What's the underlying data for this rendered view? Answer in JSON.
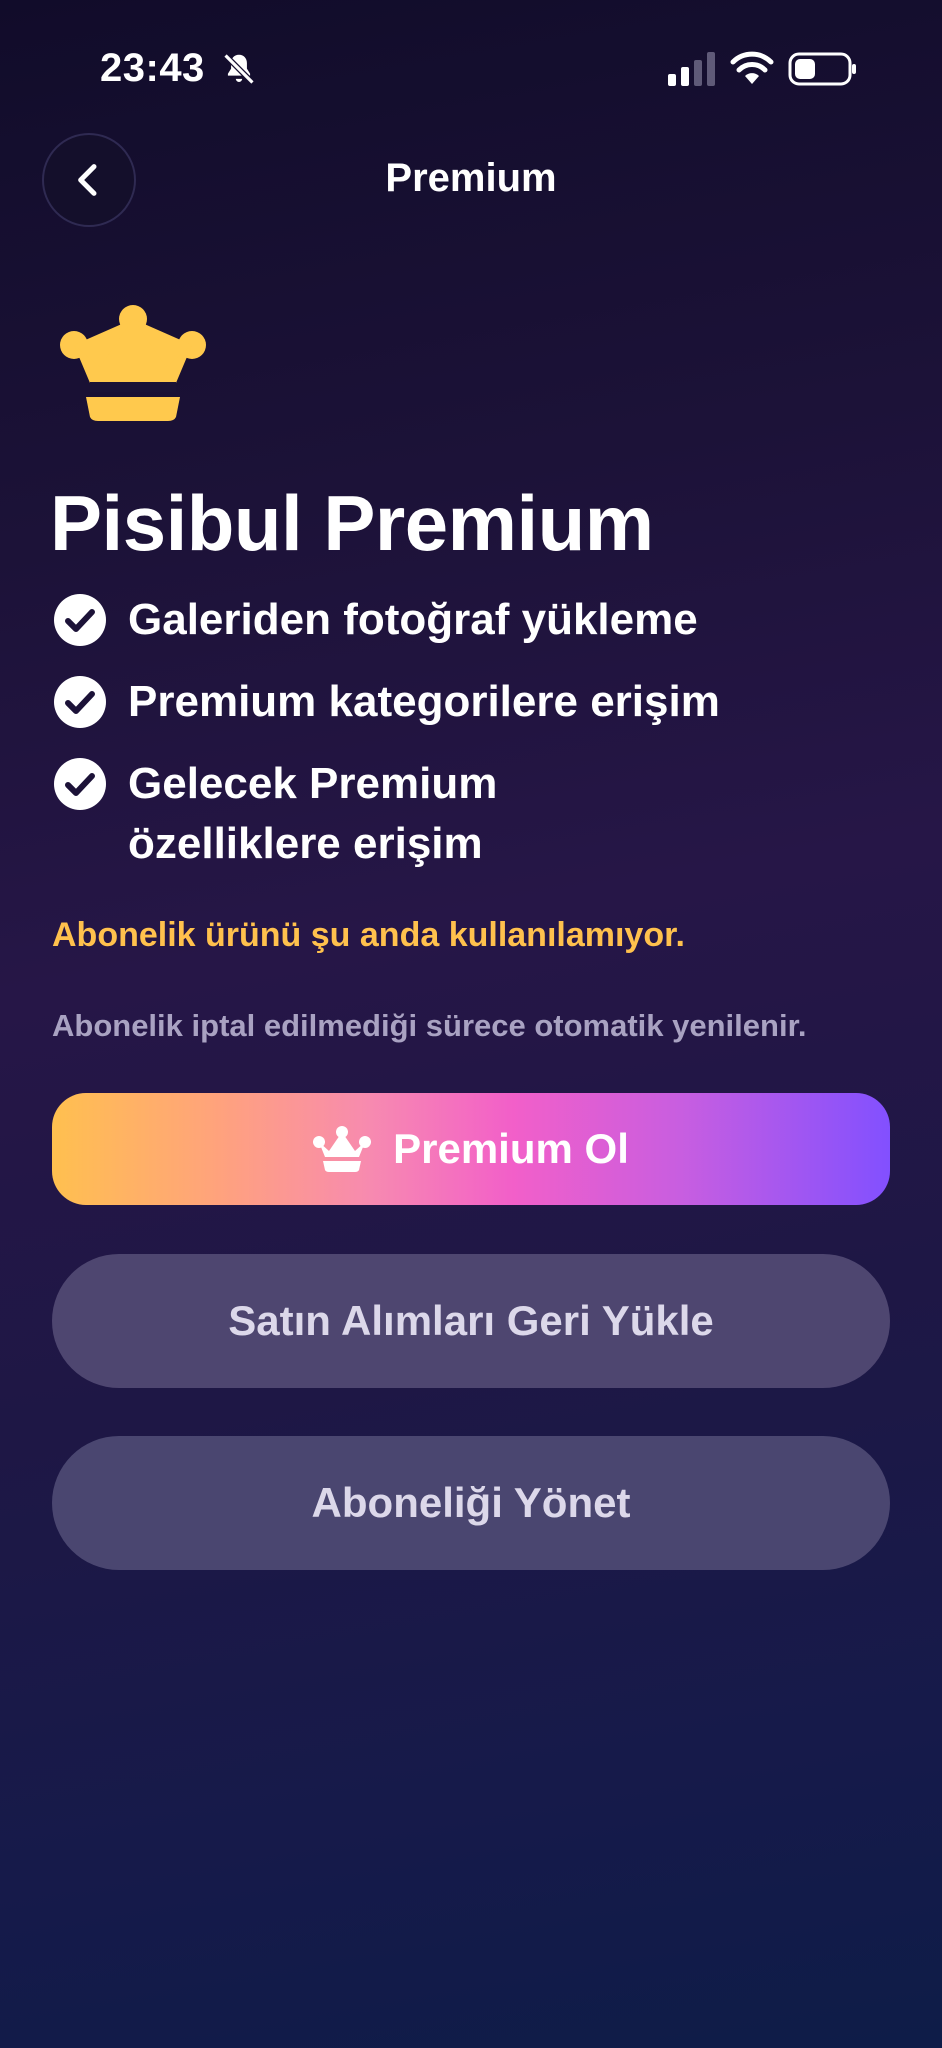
{
  "status_bar": {
    "time": "23:43",
    "icons": [
      "bell-slash-icon",
      "signal-icon",
      "wifi-icon",
      "battery-icon"
    ]
  },
  "header": {
    "title": "Premium",
    "back_icon": "chevron-left-icon"
  },
  "hero": {
    "icon": "crown-icon",
    "icon_color": "#ffc94d",
    "title": "Pisibul Premium"
  },
  "features": [
    {
      "icon": "check-circle-icon",
      "line1": "Galeriden fotoğraf yükleme",
      "line2": ""
    },
    {
      "icon": "check-circle-icon",
      "line1": "Premium kategorilere erişim",
      "line2": ""
    },
    {
      "icon": "check-circle-icon",
      "line1": "Gelecek Premium",
      "line2": "özelliklere erişim"
    }
  ],
  "warning": "Abonelik ürünü şu anda kullanılamıyor.",
  "renew_note": "Abonelik iptal edilmediği sürece otomatik yenilenir.",
  "buttons": {
    "premium": {
      "label": "Premium Ol",
      "icon": "crown-icon"
    },
    "restore": {
      "label": "Satın Alımları Geri Yükle"
    },
    "manage": {
      "label": "Aboneliği Yönet"
    }
  },
  "colors": {
    "warning": "#ffc14d",
    "accent_gradient": [
      "#ffc04f",
      "#f25fc9",
      "#8250ff"
    ],
    "secondary_button": "#4e4670"
  }
}
